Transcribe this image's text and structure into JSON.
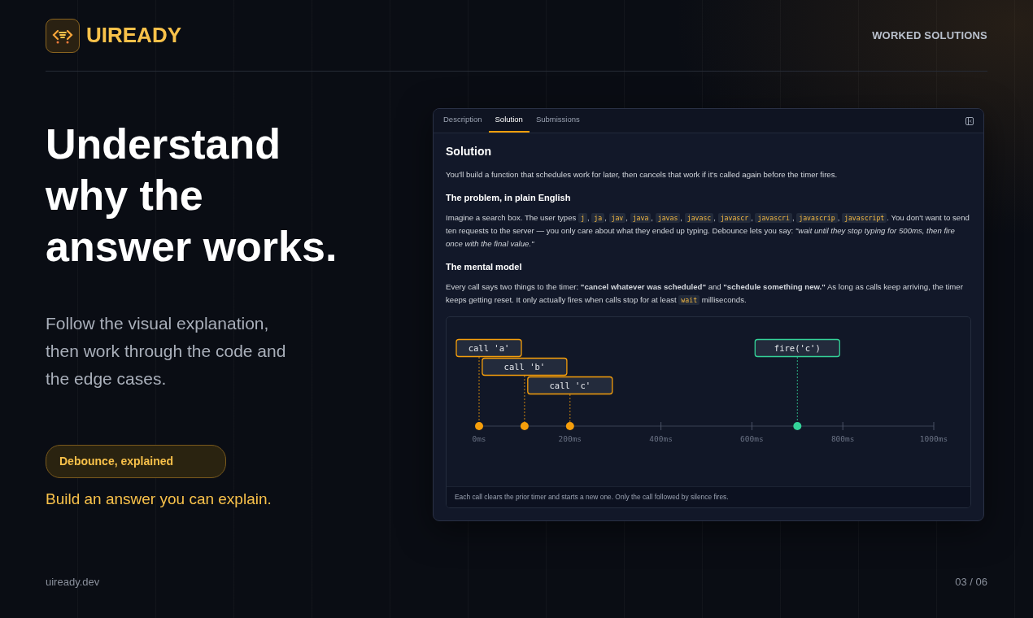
{
  "brand": {
    "name": "UIREADY"
  },
  "nav_label": "WORKED SOLUTIONS",
  "hero": {
    "title": "Understand why the answer works.",
    "subtitle": "Follow the visual explanation, then work through the code and the edge cases.",
    "badge": "Debounce, explained",
    "tagline": "Build an answer you can explain."
  },
  "panel": {
    "tabs": [
      {
        "label": "Description",
        "selected": false
      },
      {
        "label": "Solution",
        "selected": true
      },
      {
        "label": "Submissions",
        "selected": false
      }
    ],
    "heading": "Solution",
    "intro": "You'll build a function that schedules work for later, then cancels that work if it's called again before the timer fires.",
    "sections": [
      {
        "heading": "The problem, in plain English",
        "parts": [
          {
            "kind": "text",
            "text": "Imagine a search box. The user types "
          },
          {
            "kind": "code",
            "text": "j"
          },
          {
            "kind": "text",
            "text": ", "
          },
          {
            "kind": "code",
            "text": "ja"
          },
          {
            "kind": "text",
            "text": ", "
          },
          {
            "kind": "code",
            "text": "jav"
          },
          {
            "kind": "text",
            "text": ", "
          },
          {
            "kind": "code",
            "text": "java"
          },
          {
            "kind": "text",
            "text": ", "
          },
          {
            "kind": "code",
            "text": "javas"
          },
          {
            "kind": "text",
            "text": ", "
          },
          {
            "kind": "code",
            "text": "javasc"
          },
          {
            "kind": "text",
            "text": ", "
          },
          {
            "kind": "code",
            "text": "javascr"
          },
          {
            "kind": "text",
            "text": ", "
          },
          {
            "kind": "code",
            "text": "javascri"
          },
          {
            "kind": "text",
            "text": ", "
          },
          {
            "kind": "code",
            "text": "javascrip"
          },
          {
            "kind": "text",
            "text": ", "
          },
          {
            "kind": "code",
            "text": "javascript"
          },
          {
            "kind": "text",
            "text": ". You don't want to send ten requests to the server — you only care about what they ended up typing. Debounce lets you say: *\"wait until they stop typing for 500ms, then fire once with the final value.\"*"
          }
        ]
      },
      {
        "heading": "The mental model",
        "parts": [
          {
            "kind": "text",
            "text": "Every call says two things to the timer: **\"cancel whatever was scheduled\"** and **\"schedule something new.\"** As long as calls keep arriving, the timer keeps getting reset. It only actually fires when calls stop for at least "
          },
          {
            "kind": "code",
            "text": "wait"
          },
          {
            "kind": "text",
            "text": " milliseconds."
          }
        ]
      }
    ],
    "timeline": {
      "ticks": [
        "0ms",
        "200ms",
        "400ms",
        "600ms",
        "800ms",
        "1000ms"
      ],
      "events": [
        {
          "kind": "call",
          "label": "call 'a'"
        },
        {
          "kind": "call",
          "label": "call 'b'"
        },
        {
          "kind": "call",
          "label": "call 'c'"
        },
        {
          "kind": "fire",
          "label": "fire('c')"
        }
      ]
    },
    "caption": "Each call clears the prior timer and starts a new one. Only the call followed by silence fires."
  },
  "footer": {
    "site": "uiready.dev",
    "page": "03 / 06"
  }
}
